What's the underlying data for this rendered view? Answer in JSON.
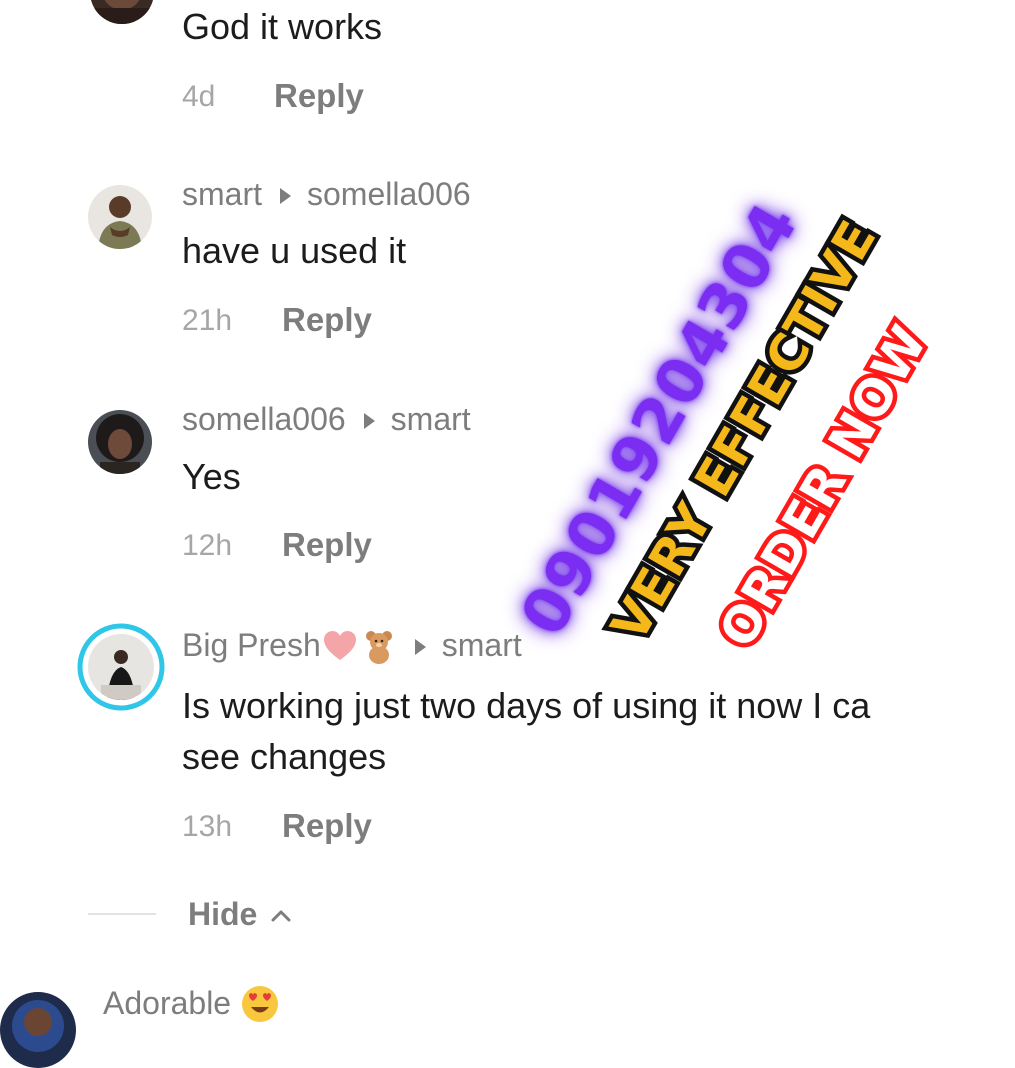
{
  "comments": [
    {
      "text": "God it works",
      "time": "4d",
      "reply_label": "Reply"
    },
    {
      "author": "smart",
      "reply_to": "somella006",
      "text": "have u used it",
      "time": "21h",
      "reply_label": "Reply"
    },
    {
      "author": "somella006",
      "reply_to": "smart",
      "text": "Yes",
      "time": "12h",
      "reply_label": "Reply"
    },
    {
      "author": "Big Presh",
      "author_emojis": [
        "heart-emoji",
        "teddy-bear-emoji"
      ],
      "reply_to": "smart",
      "text_line1": "Is working just two days of using it now I ca",
      "text_line2": "see changes",
      "time": "13h",
      "reply_label": "Reply"
    }
  ],
  "hide_label": "Hide",
  "next_comment": {
    "author": "Adorable",
    "author_emoji": "heart-eyes-emoji"
  },
  "promo": {
    "phone": "09019204304",
    "tagline": "VERY EFFECTIVE",
    "cta": "ORDER NOW",
    "colors": {
      "phone": "#7b2df2",
      "tagline": "#f5b81b",
      "cta": "#ff1a1a"
    }
  },
  "colors": {
    "body_text": "#1c1c1c",
    "secondary_text": "#7d7d7d",
    "timestamp": "#a6a6a6",
    "story_ring": "#2fc6e8"
  }
}
